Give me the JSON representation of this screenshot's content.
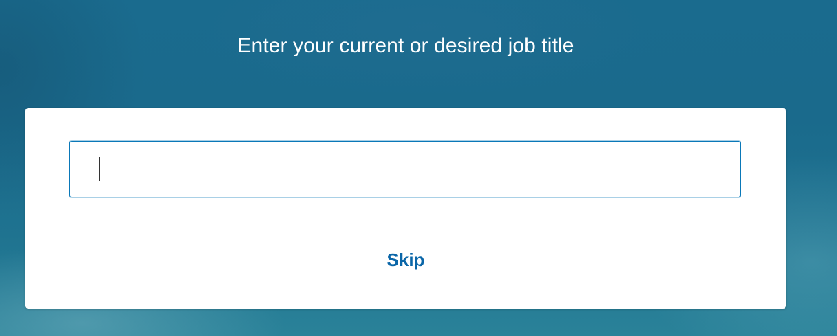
{
  "headline": "Enter your current or desired job title",
  "job_title_field": {
    "value": "",
    "placeholder": ""
  },
  "skip_label": "Skip",
  "colors": {
    "background": "#1a6b8e",
    "link": "#0a66a8",
    "input_focus_border": "#0a78b8"
  }
}
